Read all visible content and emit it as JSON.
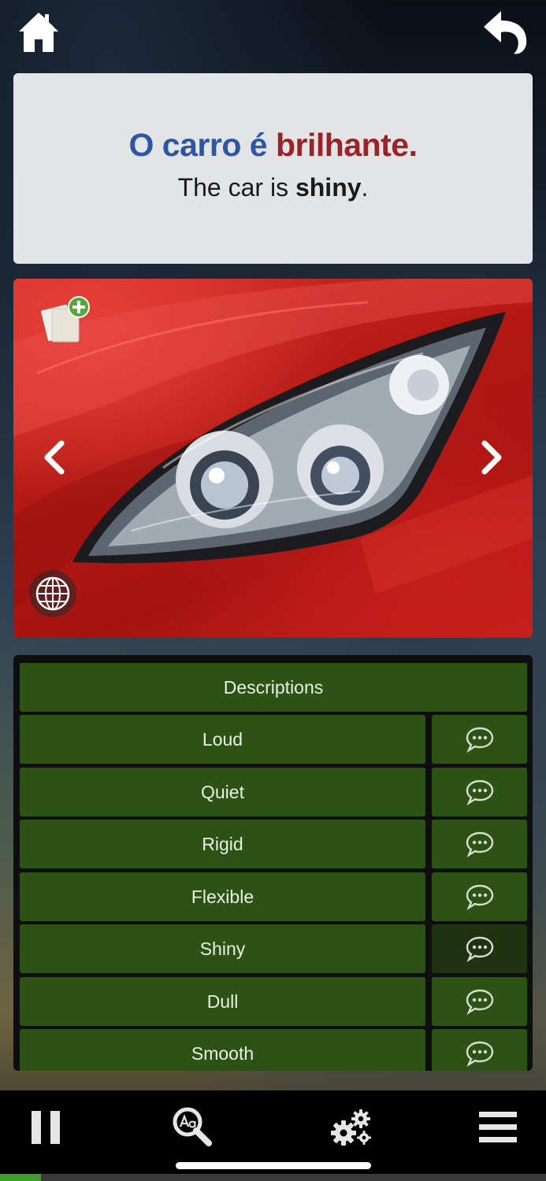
{
  "sentence": {
    "pt_part1": "O carro é ",
    "pt_part2": "brilhante.",
    "en_part1": "The car is ",
    "en_bold": "shiny",
    "en_part2": "."
  },
  "image": {
    "subject": "red car headlight"
  },
  "vocab": {
    "header": "Descriptions",
    "items": [
      {
        "label": "Loud",
        "active": false
      },
      {
        "label": "Quiet",
        "active": false
      },
      {
        "label": "Rigid",
        "active": false
      },
      {
        "label": "Flexible",
        "active": false
      },
      {
        "label": "Shiny",
        "active": true
      },
      {
        "label": "Dull",
        "active": false
      },
      {
        "label": "Smooth",
        "active": false
      }
    ]
  },
  "progress": {
    "fraction": 0.075
  },
  "colors": {
    "pt_blue": "#2f56a3",
    "pt_red": "#9b2226",
    "row_green": "#2c5314",
    "progress_green": "#3f9b2a"
  },
  "icons": {
    "top_left": "home-icon",
    "top_right": "back-arrow-icon",
    "image_top_left": "add-flashcard-icon",
    "image_bottom_left": "globe-icon",
    "image_prev": "chevron-left-icon",
    "image_next": "chevron-right-icon",
    "row_action": "speech-bubble-icon",
    "bottom": [
      "pause-icon",
      "dictionary-search-icon",
      "settings-gears-icon",
      "menu-icon"
    ]
  }
}
